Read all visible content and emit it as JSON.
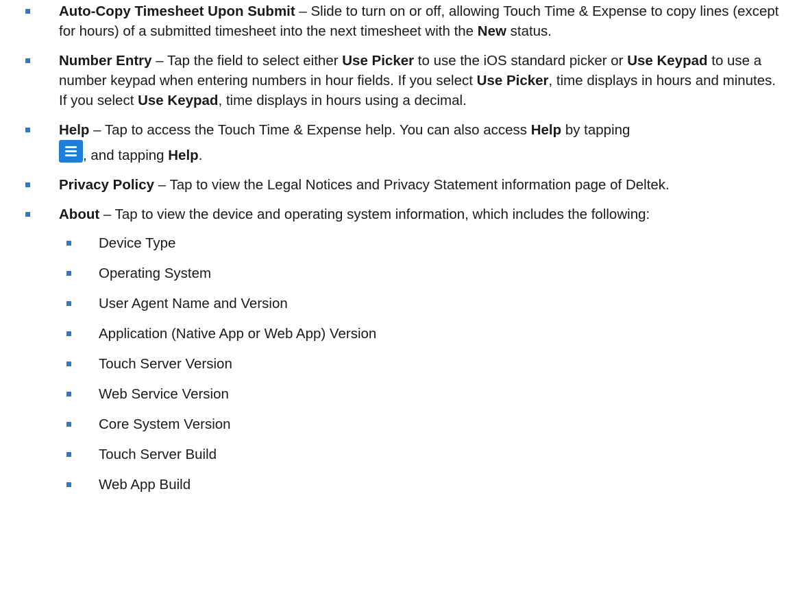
{
  "items": [
    {
      "term": "Auto-Copy Timesheet Upon Submit",
      "text1": " – Slide to turn on or off, allowing Touch Time & Expense to copy lines (except for hours) of a submitted timesheet into the next timesheet with the ",
      "bold1": "New",
      "text2": " status."
    },
    {
      "term": "Number Entry",
      "text1": " – Tap the field to select either ",
      "bold1": "Use Picker",
      "text2": " to use the iOS standard picker or ",
      "bold2": "Use Keypad",
      "text3": " to use a number keypad when entering numbers in hour fields. If you select ",
      "bold3": "Use Picker",
      "text4": ", time displays in hours and minutes. If you select ",
      "bold4": "Use Keypad",
      "text5": ", time displays in hours using a decimal."
    },
    {
      "term": "Help",
      "text1": " – Tap to access the Touch Time & Expense help. You can also access ",
      "bold1": "Help",
      "text2": " by tapping ",
      "icon": "menu-icon",
      "text3": ", and tapping ",
      "bold2": "Help",
      "text4": "."
    },
    {
      "term": "Privacy Policy",
      "text1": " – Tap to view the Legal Notices and Privacy Statement information page of Deltek."
    },
    {
      "term": "About",
      "text1": " – Tap to view the device and operating system information, which includes the following:",
      "subitems": [
        "Device Type",
        "Operating System",
        "User Agent Name and Version",
        "Application (Native App or Web App) Version",
        "Touch Server Version",
        "Web Service Version",
        "Core System Version",
        "Touch Server Build",
        "Web App Build"
      ]
    }
  ],
  "colors": {
    "bullet": "#2e75d6",
    "icon_bg": "#1e7fd6"
  }
}
